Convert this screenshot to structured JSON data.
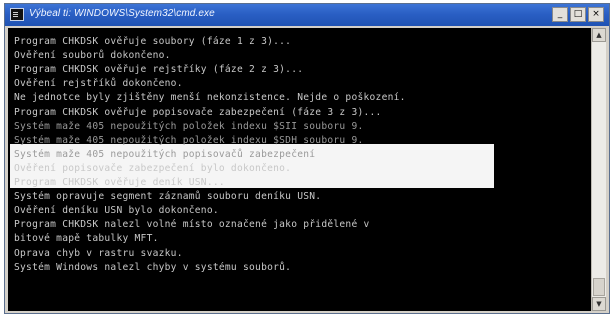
{
  "window": {
    "title": "Výbeal ti: WINDOWS\\System32\\cmd.exe",
    "minimize_glyph": "_",
    "maximize_glyph": "□",
    "close_glyph": "×"
  },
  "console": {
    "lines": [
      "Program CHKDSK ověřuje soubory (fáze 1 z 3)...",
      "Ověření souborů dokončeno.",
      "Program CHKDSK ověřuje rejstříky (fáze 2 z 3)...",
      "Ověření rejstříků dokončeno.",
      "Ne jednotce byly zjištěny menší nekonzistence. Nejde o poškození.",
      "Program CHKDSK ověřuje popisovače zabezpečení (fáze 3 z 3)...",
      "Systém maže 405 nepoužitých položek indexu $SII souboru 9.",
      "Systém maže 405 nepoužitých položek indexu $SDH souboru 9.",
      "Systém maže 405 nepoužitých popisovačů zabezpečení",
      "Ověření popisovače zabezpečení bylo dokončeno.",
      "Program CHKDSK ověřuje deník USN...",
      "Systém opravuje segment záznamů souboru deníku USN.",
      "Ověření deníku USN bylo dokončeno.",
      "Program CHKDSK nalezl volné místo označené jako přidělené v",
      "bitové mapě tabulky MFT.",
      "Oprava chyb v rastru svazku.",
      "Systém Windows nalezl chyby v systému souborů."
    ],
    "highlighted_line_indices": [
      6,
      7,
      8
    ]
  },
  "colors": {
    "console_background": "#000000",
    "console_text": "#c8c8c8",
    "title_bar": "#2a5fc4",
    "highlight_background": "#f5f5f5"
  },
  "icons": {
    "window_icon": "console-icon"
  }
}
